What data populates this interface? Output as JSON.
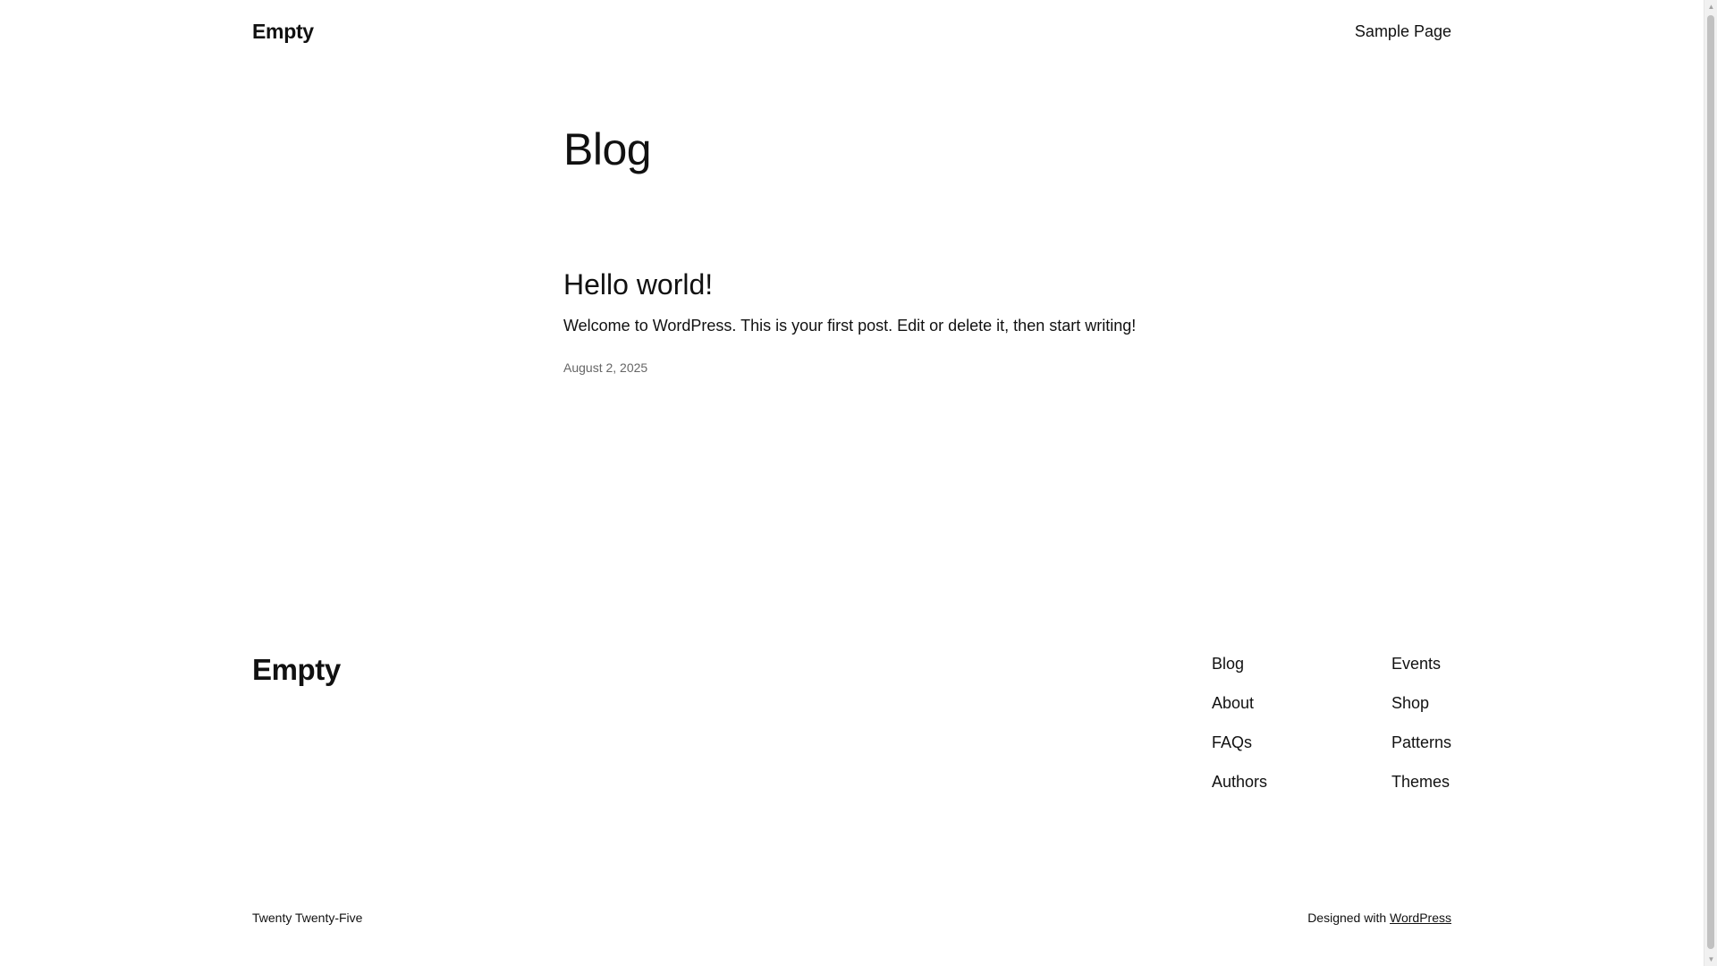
{
  "header": {
    "site_title": "Empty",
    "nav": [
      {
        "label": "Sample Page"
      }
    ]
  },
  "main": {
    "page_title": "Blog",
    "posts": [
      {
        "title": "Hello world!",
        "excerpt": "Welcome to WordPress. This is your first post. Edit or delete it, then start writing!",
        "date": "August 2, 2025"
      }
    ]
  },
  "footer": {
    "site_title": "Empty",
    "columns": [
      [
        "Blog",
        "About",
        "FAQs",
        "Authors"
      ],
      [
        "Events",
        "Shop",
        "Patterns",
        "Themes"
      ]
    ],
    "theme_name": "Twenty Twenty-Five",
    "credit_prefix": "Designed with",
    "credit_link": "WordPress"
  },
  "colors": {
    "text": "#111111",
    "muted": "#666666",
    "background": "#ffffff"
  }
}
